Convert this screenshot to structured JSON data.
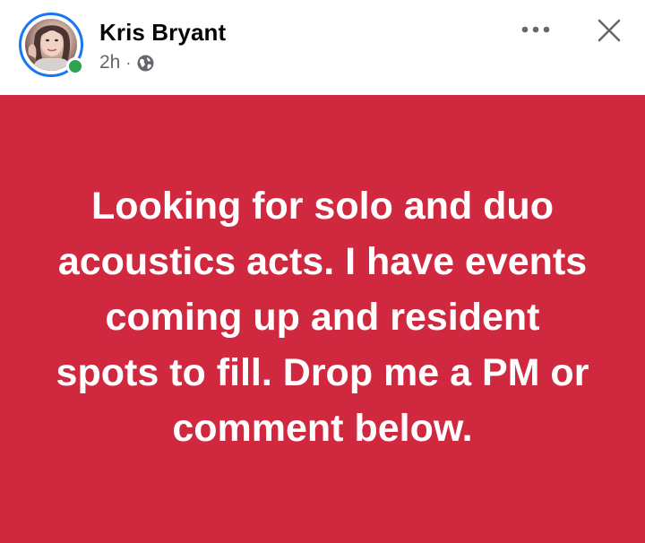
{
  "post": {
    "author": "Kris Bryant",
    "timestamp": "2h",
    "separator": "·",
    "privacy_icon": "globe-icon",
    "text": "Looking for solo and duo acoustics acts. I have events coming up and resident spots to fill. Drop me a PM or comment below.",
    "background_color": "#d0283f",
    "text_color": "#ffffff"
  },
  "header": {
    "more_icon": "more-dots-icon",
    "close_icon": "close-icon",
    "online_status_color": "#31a24c",
    "story_ring_color": "#1877f2"
  }
}
